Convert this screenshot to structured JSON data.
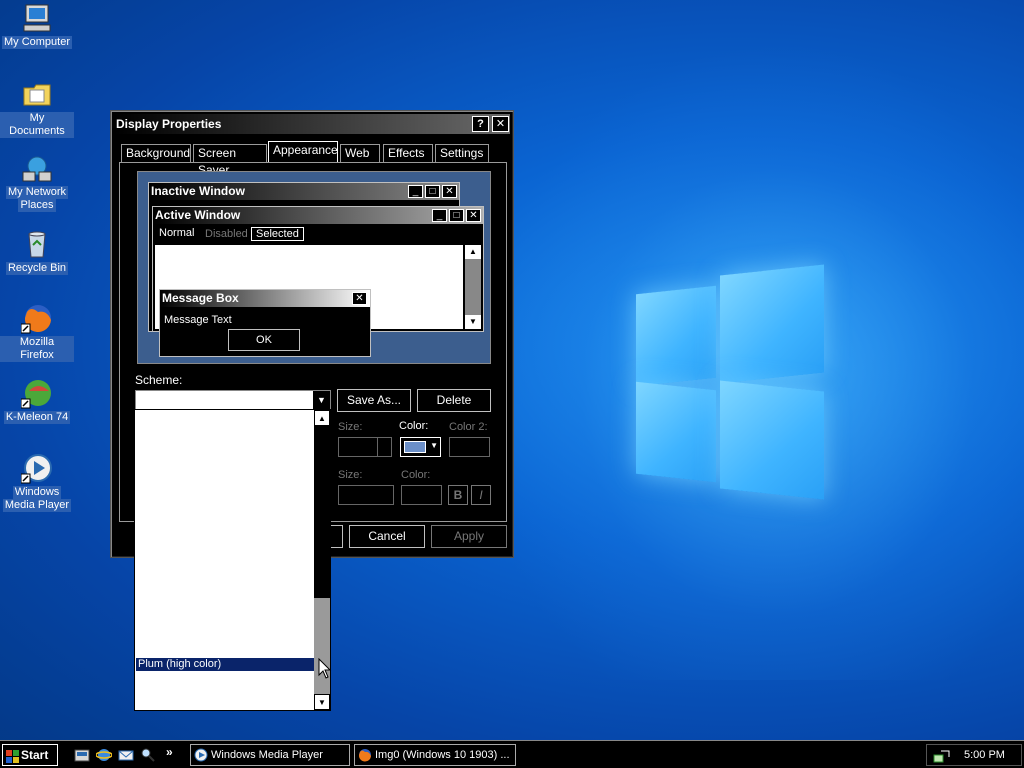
{
  "desktop": {
    "icons": [
      {
        "label": "My Computer",
        "icon": "computer-icon"
      },
      {
        "label": "My Documents",
        "icon": "folder-icon"
      },
      {
        "label": "My Network",
        "label2": "Places",
        "icon": "network-icon"
      },
      {
        "label": "Recycle Bin",
        "icon": "recycle-bin-icon"
      },
      {
        "label": "Mozilla Firefox",
        "icon": "firefox-icon"
      },
      {
        "label": "K-Meleon 74",
        "icon": "kmeleon-icon"
      },
      {
        "label": "Windows",
        "label2": "Media Player",
        "icon": "media-player-icon"
      }
    ]
  },
  "window": {
    "title": "Display Properties",
    "help_glyph": "?",
    "close_glyph": "✕",
    "tabs": [
      {
        "label": "Background"
      },
      {
        "label": "Screen Saver"
      },
      {
        "label": "Appearance",
        "active": true
      },
      {
        "label": "Web"
      },
      {
        "label": "Effects"
      },
      {
        "label": "Settings"
      }
    ],
    "preview": {
      "inactive_title": "Inactive Window",
      "active_title": "Active Window",
      "menu_normal": "Normal",
      "menu_disabled": "Disabled",
      "menu_selected": "Selected",
      "msgbox_title": "Message Box",
      "msgbox_text": "Message Text",
      "msgbox_ok": "OK"
    },
    "scheme_label": "Scheme:",
    "scheme_value": "",
    "save_as": "Save As...",
    "delete": "Delete",
    "size_label_1": "Size:",
    "color_label_1": "Color:",
    "color2_label": "Color 2:",
    "size_label_2": "Size:",
    "color_label_2": "Color:",
    "bold_glyph": "B",
    "italic_glyph": "I",
    "cancel": "Cancel",
    "apply": "Apply",
    "selected_color": "#6b8fc8"
  },
  "scheme_dropdown": {
    "highlighted_item": "Plum (high color)",
    "highlight_color": "#0a246a"
  },
  "taskbar": {
    "start": "Start",
    "tasks": [
      {
        "label": "Windows Media Player"
      },
      {
        "label": "Img0 (Windows 10 1903) ..."
      }
    ],
    "chevron": "»",
    "clock": "5:00 PM"
  }
}
